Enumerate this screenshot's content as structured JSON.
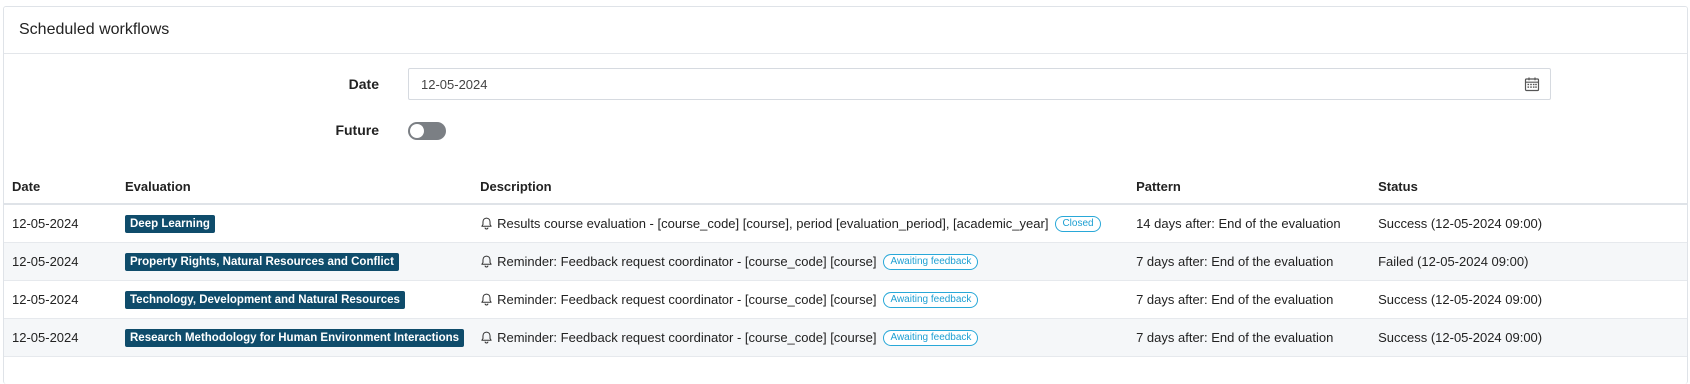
{
  "card": {
    "title": "Scheduled workflows"
  },
  "filters": {
    "date_label": "Date",
    "date_value": "12-05-2024",
    "future_label": "Future",
    "future_enabled": false
  },
  "table": {
    "headers": [
      "Date",
      "Evaluation",
      "Description",
      "Pattern",
      "Status"
    ],
    "rows": [
      {
        "date": "12-05-2024",
        "evaluation": "Deep Learning",
        "description": "Results course evaluation - [course_code] [course], period [evaluation_period], [academic_year]",
        "tag": "Closed",
        "pattern": "14 days after: End of the evaluation",
        "status": "Success (12-05-2024 09:00)"
      },
      {
        "date": "12-05-2024",
        "evaluation": "Property Rights, Natural Resources and Conflict",
        "description": "Reminder: Feedback request coordinator - [course_code] [course]",
        "tag": "Awaiting feedback",
        "pattern": "7 days after: End of the evaluation",
        "status": "Failed (12-05-2024 09:00)"
      },
      {
        "date": "12-05-2024",
        "evaluation": "Technology, Development and Natural Resources",
        "description": "Reminder: Feedback request coordinator - [course_code] [course]",
        "tag": "Awaiting feedback",
        "pattern": "7 days after: End of the evaluation",
        "status": "Success (12-05-2024 09:00)"
      },
      {
        "date": "12-05-2024",
        "evaluation": "Research Methodology for Human Environment Interactions",
        "description": "Reminder: Feedback request coordinator - [course_code] [course]",
        "tag": "Awaiting feedback",
        "pattern": "7 days after: End of the evaluation",
        "status": "Success (12-05-2024 09:00)"
      }
    ]
  },
  "colors": {
    "badge": "#0f4c6b",
    "pill": "#1d9fd2",
    "toggle_off": "#7b7f84"
  },
  "icons": {
    "calendar": "calendar-icon",
    "bell": "bell-icon"
  }
}
